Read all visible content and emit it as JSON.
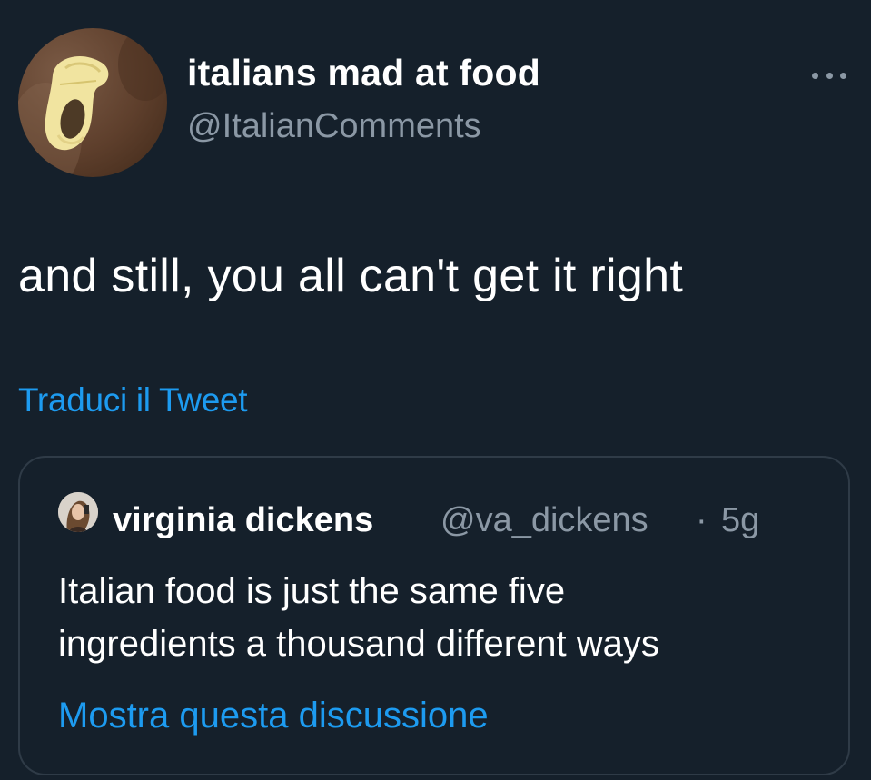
{
  "tweet": {
    "display_name": "italians mad at food",
    "handle": "@ItalianComments",
    "avatar_icon": "pasta-shell-avatar",
    "more_icon": "more-options-icon",
    "text": "and still, you all can't get it right",
    "translate_label": "Traduci il Tweet"
  },
  "quote": {
    "display_name": "virginia dickens",
    "handle": "@va_dickens",
    "separator": "·",
    "time": "5g",
    "avatar_icon": "profile-photo-avatar",
    "text_lines": [
      "Italian food is just the same five",
      "ingredients a thousand different ways"
    ],
    "show_thread_label": "Mostra questa discussione"
  },
  "colors": {
    "background": "#15202b",
    "primary_text": "#ffffff",
    "secondary_text": "#8b98a5",
    "link": "#1d9bf0",
    "border": "#2f3b47"
  }
}
